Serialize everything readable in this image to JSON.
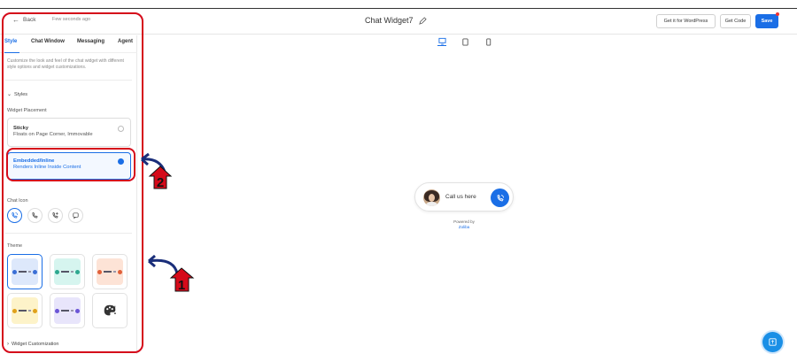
{
  "topbar": {
    "back_label": "Back",
    "saved_status": "Few seconds ago",
    "widget_title": "Chat Widget7",
    "wordpress_label": "Get it for WordPress",
    "get_code_label": "Get Code",
    "save_label": "Save"
  },
  "devices": [
    "desktop-icon",
    "tablet-icon",
    "mobile-icon"
  ],
  "sidebar": {
    "tabs": [
      "Style",
      "Chat Window",
      "Messaging",
      "Agent"
    ],
    "active_tab": "Style",
    "description": "Customize the look and feel of the chat widget with different style options and widget customizations.",
    "styles_section": "Styles",
    "widget_placement_label": "Widget Placement",
    "placements": [
      {
        "title": "Sticky",
        "subtitle": "Floats on Page Corner, Immovable",
        "selected": false
      },
      {
        "title": "Embedded/Inline",
        "subtitle": "Renders Inline Inside Content",
        "selected": true
      }
    ],
    "chat_icon_label": "Chat Icon",
    "chat_icons": [
      "phone-chat-icon",
      "phone-icon",
      "phone-plus-icon",
      "chat-bubble-icon"
    ],
    "theme_label": "Theme",
    "themes": [
      {
        "bg": "#dde8fb",
        "accent": "#3b6fd6",
        "selected": true
      },
      {
        "bg": "#d6f5ef",
        "accent": "#2ea88f",
        "selected": false
      },
      {
        "bg": "#fde3d6",
        "accent": "#e0603a",
        "selected": false
      },
      {
        "bg": "#fdf3c9",
        "accent": "#e0a11a",
        "selected": false
      },
      {
        "bg": "#e8e5fb",
        "accent": "#6b55d6",
        "selected": false
      },
      {
        "bg": "#f2f2f2",
        "accent": "#333333",
        "selected": false
      }
    ],
    "widget_customization_section": "Widget Customization"
  },
  "preview": {
    "call_text": "Call us here",
    "powered_by": "Powered by",
    "brand": "Zoliba"
  },
  "annotations": {
    "badge_1": "1",
    "badge_2": "2",
    "color": "#d50a1a"
  },
  "colors": {
    "accent": "#1a6ee6"
  }
}
